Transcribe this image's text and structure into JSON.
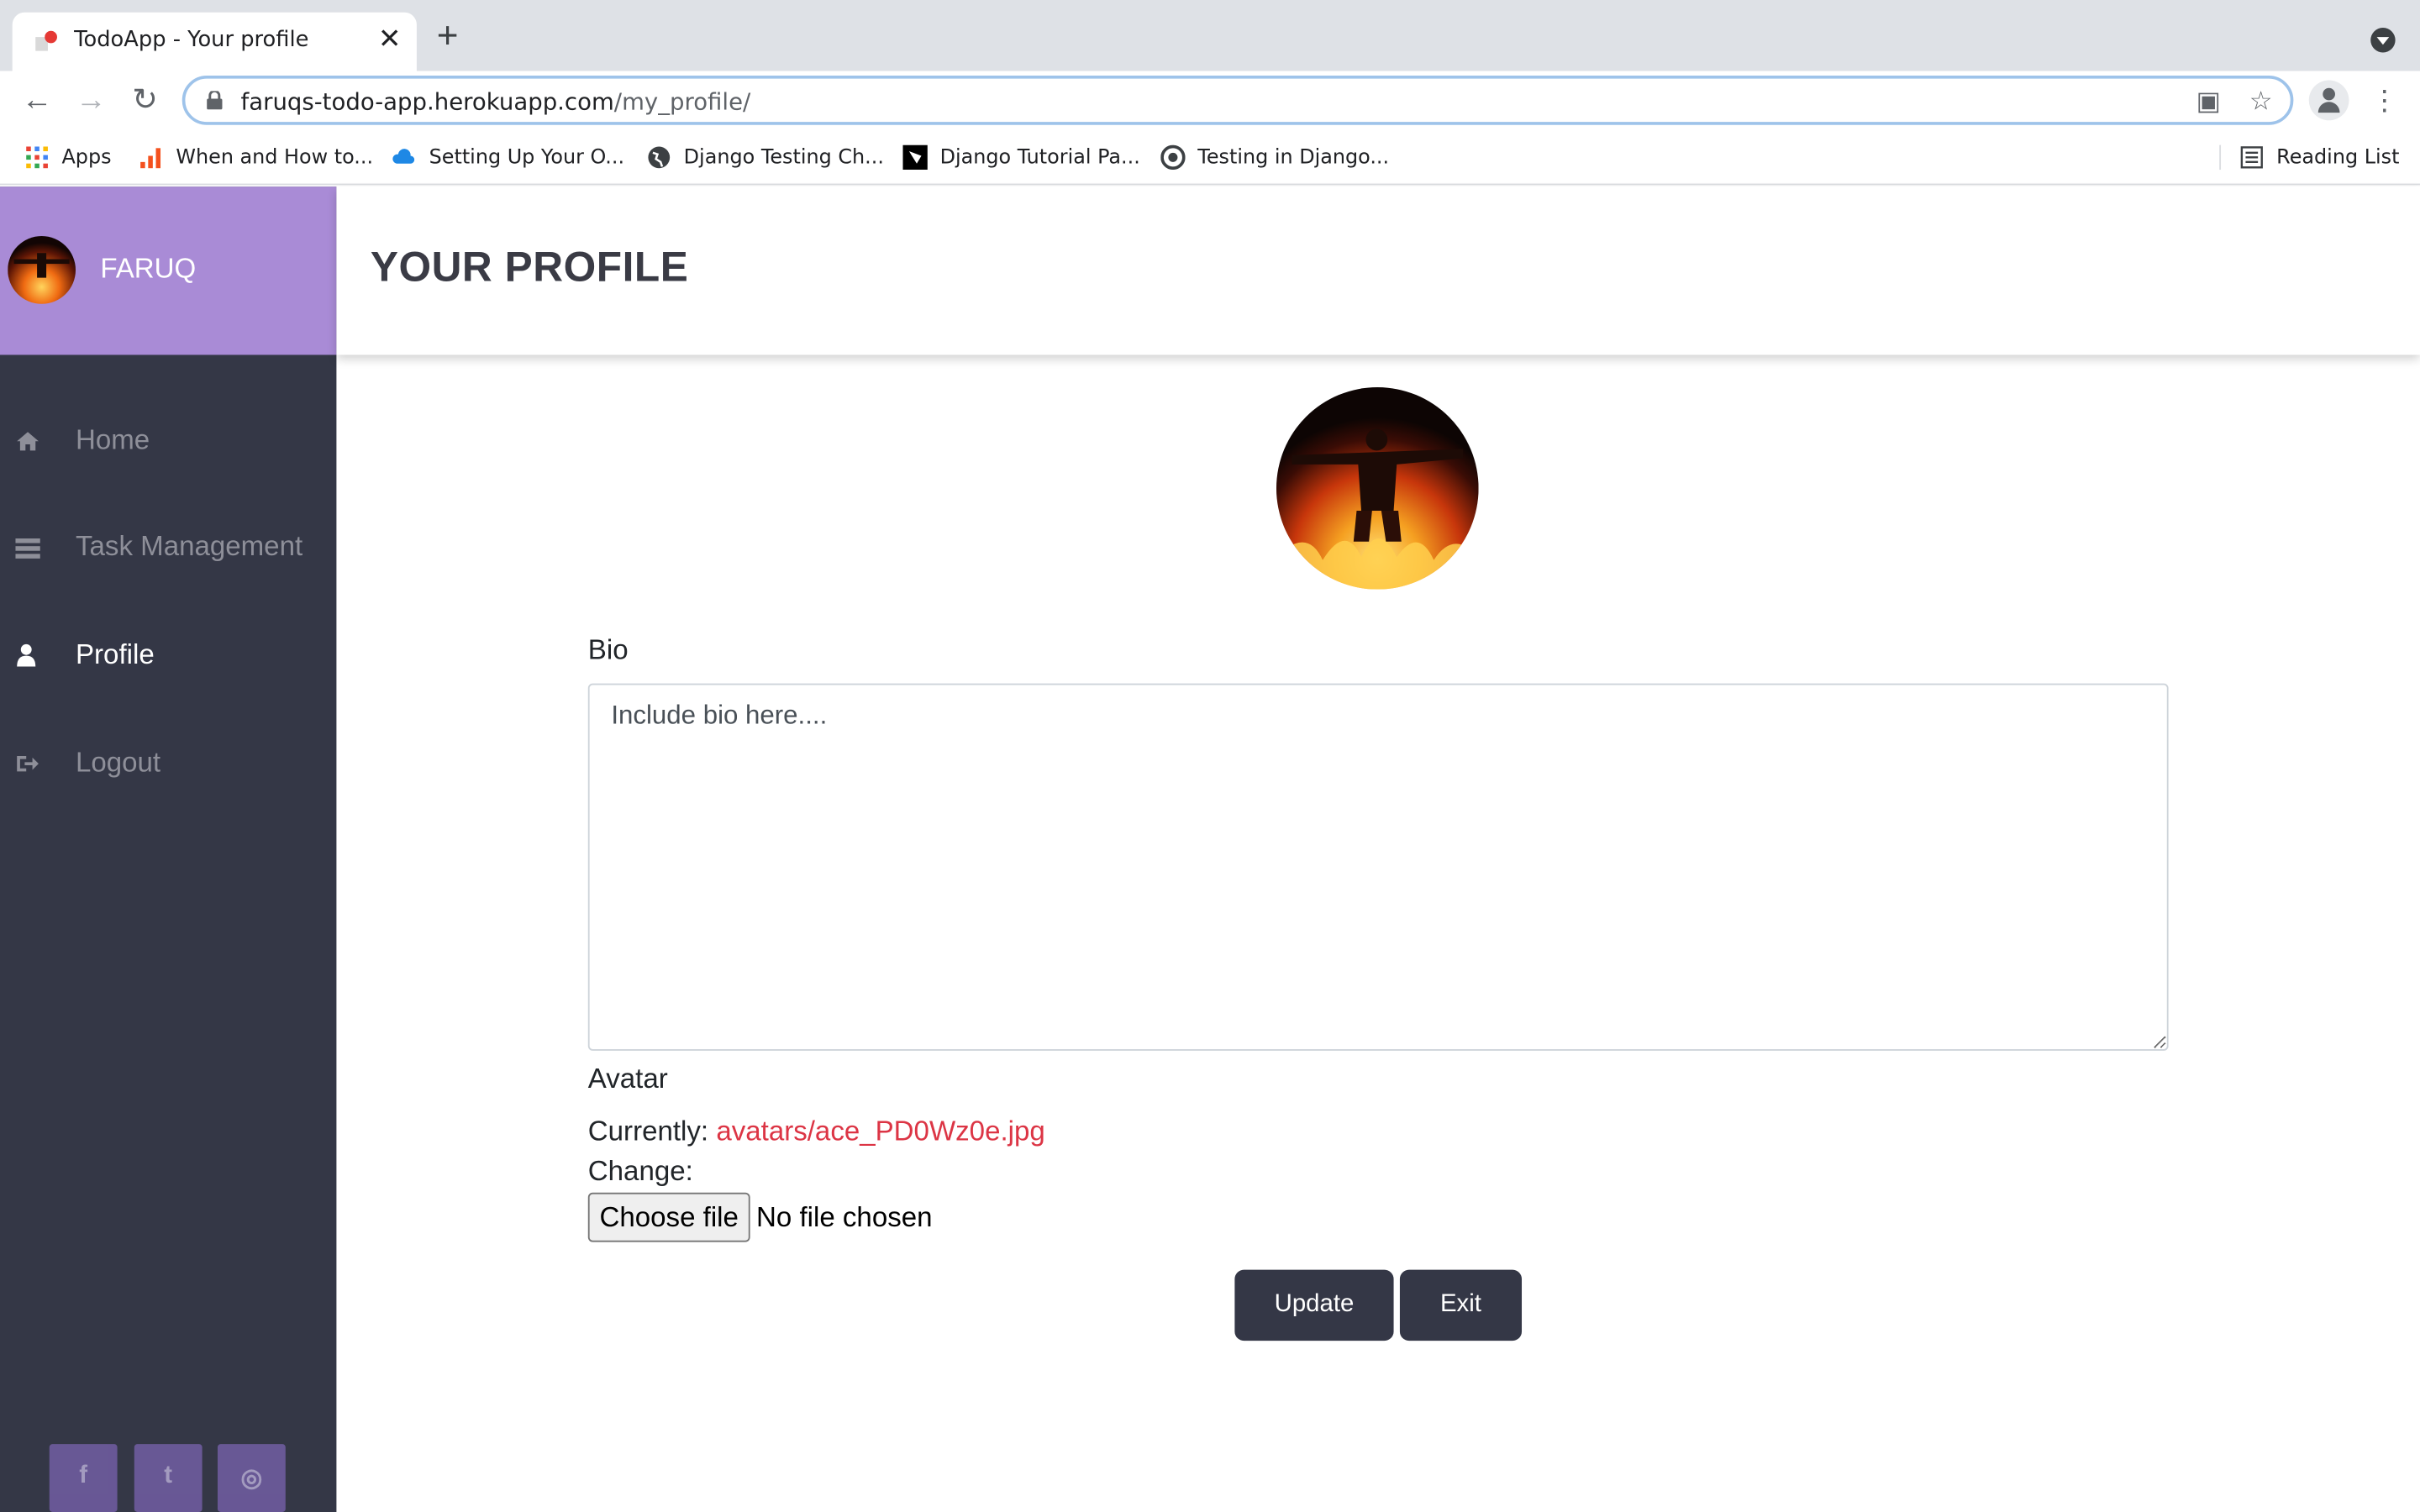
{
  "browser": {
    "tab_title": "TodoApp - Your profile",
    "url_host": "faruqs-todo-app.herokuapp.com",
    "url_path": "/my_profile/",
    "bookmarks": [
      {
        "label": "Apps",
        "icon": "apps-grid-icon"
      },
      {
        "label": "When and How to...",
        "icon": "bars-icon"
      },
      {
        "label": "Setting Up Your O...",
        "icon": "cloud-icon"
      },
      {
        "label": "Django Testing Ch...",
        "icon": "globe-icon"
      },
      {
        "label": "Django Tutorial Pa...",
        "icon": "mdn-icon"
      },
      {
        "label": "Testing in Django...",
        "icon": "python-icon"
      }
    ],
    "reading_list": "Reading List"
  },
  "sidebar": {
    "username": "FARUQ",
    "items": [
      {
        "label": "Home",
        "icon": "home-icon",
        "active": false
      },
      {
        "label": "Task Management",
        "icon": "tasks-icon",
        "active": false
      },
      {
        "label": "Profile",
        "icon": "user-icon",
        "active": true
      },
      {
        "label": "Logout",
        "icon": "logout-icon",
        "active": false
      }
    ],
    "social": [
      {
        "label": "f",
        "icon": "facebook-icon"
      },
      {
        "label": "t",
        "icon": "twitter-icon"
      },
      {
        "label": "◎",
        "icon": "instagram-icon"
      }
    ]
  },
  "header": {
    "title": "YOUR PROFILE"
  },
  "form": {
    "bio_label": "Bio",
    "bio_placeholder": "Include bio here....",
    "avatar_label": "Avatar",
    "currently_label": "Currently:",
    "current_file": "avatars/ace_PD0Wz0e.jpg",
    "change_label": "Change:",
    "choose_file": "Choose file",
    "no_file": "No file chosen",
    "update": "Update",
    "exit": "Exit"
  },
  "colors": {
    "sidebar": "#343746",
    "sidebar_header": "#a98bd6",
    "link": "#dc3545"
  }
}
